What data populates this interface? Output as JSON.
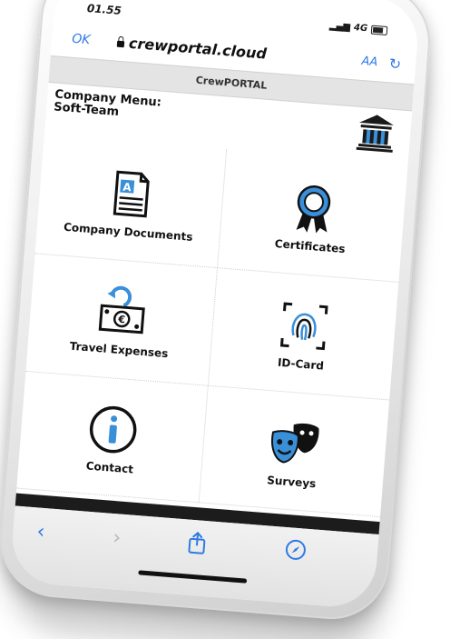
{
  "status": {
    "time": "01.55",
    "network": "4G"
  },
  "browser": {
    "ok_label": "OK",
    "url": "crewportal.cloud",
    "text_size_label": "AA"
  },
  "app": {
    "title": "CrewPORTAL"
  },
  "company": {
    "menu_label": "Company Menu:",
    "name": "Soft-Team"
  },
  "tiles": [
    {
      "label": "Company Documents",
      "icon": "document-icon"
    },
    {
      "label": "Certificates",
      "icon": "certificate-ribbon-icon"
    },
    {
      "label": "Travel Expenses",
      "icon": "travel-expenses-icon"
    },
    {
      "label": "ID-Card",
      "icon": "fingerprint-icon"
    },
    {
      "label": "Contact",
      "icon": "info-icon"
    },
    {
      "label": "Surveys",
      "icon": "theater-masks-icon"
    }
  ],
  "colors": {
    "accent": "#2f7ae5",
    "icon_blue": "#3a8fd9"
  }
}
